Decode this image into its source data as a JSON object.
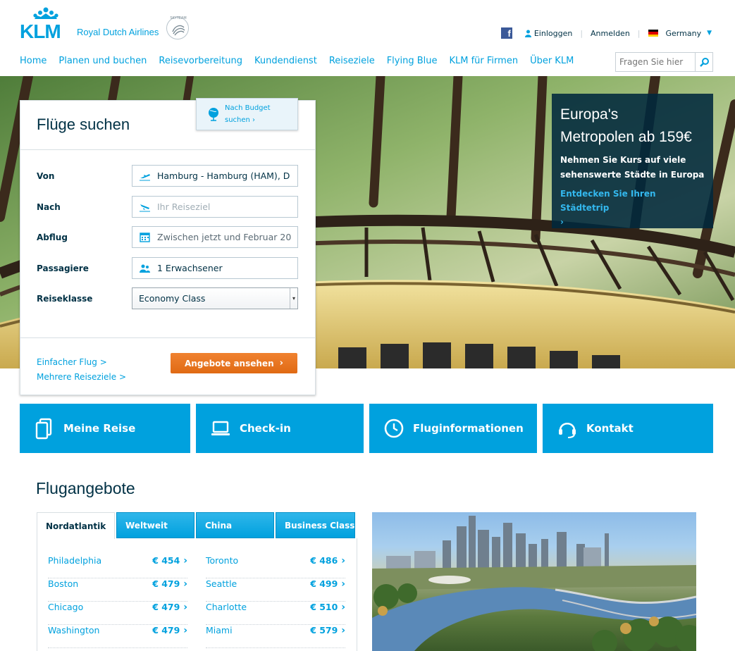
{
  "brand": {
    "name": "KLM",
    "tagline": "Royal Dutch Airlines",
    "alliance": "SKYTEAM",
    "primary_color": "#00a1de",
    "accent_color": "#e87722"
  },
  "top_links": {
    "login": "Einloggen",
    "register": "Anmelden",
    "country": "Germany"
  },
  "nav": {
    "items": [
      "Home",
      "Planen und buchen",
      "Reisevorbereitung",
      "Kundendienst",
      "Reiseziele",
      "Flying Blue",
      "KLM für Firmen",
      "Über KLM"
    ],
    "search_placeholder": "Fragen Sie hier"
  },
  "promo": {
    "title_line1": "Europa's",
    "title_line2": "Metropolen ab 159€",
    "text": "Nehmen Sie Kurs auf viele sehenswerte Städte in Europa",
    "link": "Entdecken Sie Ihren Städtetrip"
  },
  "booking": {
    "title": "Flüge suchen",
    "budget_line1": "Nach Budget",
    "budget_line2": "suchen",
    "fields": {
      "from_label": "Von",
      "from_value": "Hamburg - Hamburg (HAM), D",
      "to_label": "Nach",
      "to_placeholder": "Ihr Reiseziel",
      "departure_label": "Abflug",
      "departure_value": "Zwischen jetzt und Februar 20",
      "passengers_label": "Passagiere",
      "passengers_value": "1 Erwachsener",
      "class_label": "Reiseklasse",
      "class_value": "Economy Class"
    },
    "one_way": "Einfacher Flug >",
    "multi_city": "Mehrere Reiseziele >",
    "cta": "Angebote ansehen"
  },
  "tiles": [
    "Meine Reise",
    "Check-in",
    "Fluginformationen",
    "Kontakt"
  ],
  "offers": {
    "title": "Flugangebote",
    "tabs": [
      "Nordatlantik",
      "Weltweit",
      "China",
      "Business Class"
    ],
    "active_tab": "Nordatlantik",
    "left": [
      {
        "city": "Philadelphia",
        "price": "€ 454"
      },
      {
        "city": "Boston",
        "price": "€ 479"
      },
      {
        "city": "Chicago",
        "price": "€ 479"
      },
      {
        "city": "Washington",
        "price": "€ 479"
      }
    ],
    "right": [
      {
        "city": "Toronto",
        "price": "€ 486"
      },
      {
        "city": "Seattle",
        "price": "€ 499"
      },
      {
        "city": "Charlotte",
        "price": "€ 510"
      },
      {
        "city": "Miami",
        "price": "€ 579"
      }
    ]
  }
}
